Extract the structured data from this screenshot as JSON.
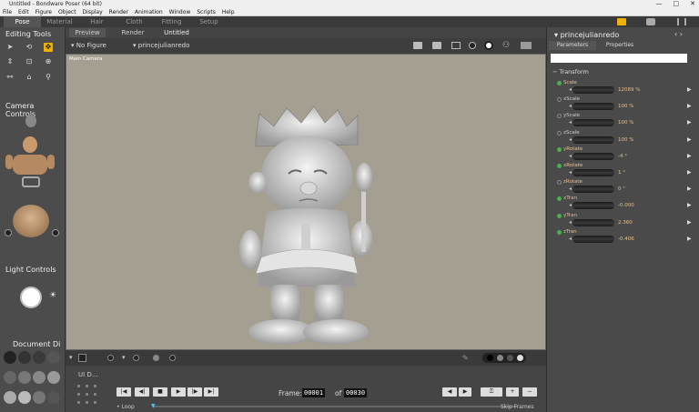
{
  "window": {
    "title": "Untitled - Bondware Poser (64 bit)",
    "controls": [
      "—",
      "□",
      "✕"
    ]
  },
  "menu": [
    "File",
    "Edit",
    "Figure",
    "Object",
    "Display",
    "Render",
    "Animation",
    "Window",
    "Scripts",
    "Help"
  ],
  "rooms": [
    {
      "label": "Pose",
      "active": true
    },
    {
      "label": "Material"
    },
    {
      "label": "Hair"
    },
    {
      "label": "Cloth"
    },
    {
      "label": "Fitting"
    },
    {
      "label": "Setup"
    }
  ],
  "left": {
    "editing_tools": "Editing Tools",
    "camera_controls": "Camera Controls",
    "light_controls": "Light Controls",
    "document_display": "Document  Di",
    "ui_dots": "UI D..."
  },
  "view": {
    "tabs": [
      "Preview",
      "Render",
      "Untitled"
    ],
    "figure_menu": "No Figure",
    "actor_menu": "princejulianredo",
    "camera_label": "Main Camera"
  },
  "timeline": {
    "frame_label": "Frame:",
    "frame_current": "00001",
    "of_label": "of",
    "frame_total": "00030",
    "loop_label": "Loop",
    "skip_frames_label": "Skip Frames"
  },
  "right": {
    "title": "princejulianredo",
    "tabs": [
      "Parameters",
      "Properties"
    ],
    "search_placeholder": "",
    "group": "Transform",
    "params": [
      {
        "label": "Scale",
        "value": "12089 %",
        "dot": "#4caf50",
        "active": true
      },
      {
        "label": "xScale",
        "value": "100 %",
        "dot": "none",
        "active": false
      },
      {
        "label": "yScale",
        "value": "100 %",
        "dot": "none",
        "active": false
      },
      {
        "label": "zScale",
        "value": "100 %",
        "dot": "none",
        "active": false
      },
      {
        "label": "yRotate",
        "value": "-4 °",
        "dot": "#4caf50",
        "active": true
      },
      {
        "label": "xRotate",
        "value": "1 °",
        "dot": "#4caf50",
        "active": true
      },
      {
        "label": "zRotate",
        "value": "0 °",
        "dot": "none",
        "active": true
      },
      {
        "label": "xTran",
        "value": "-0.000",
        "dot": "#4caf50",
        "active": true
      },
      {
        "label": "yTran",
        "value": "2.360",
        "dot": "#4caf50",
        "active": true
      },
      {
        "label": "zTran",
        "value": "-0.406",
        "dot": "#4caf50",
        "active": true
      }
    ]
  },
  "colors": {
    "accent": "#f0b000",
    "viewport_bg": "#a59f92",
    "param_text": "#e6c08a"
  }
}
